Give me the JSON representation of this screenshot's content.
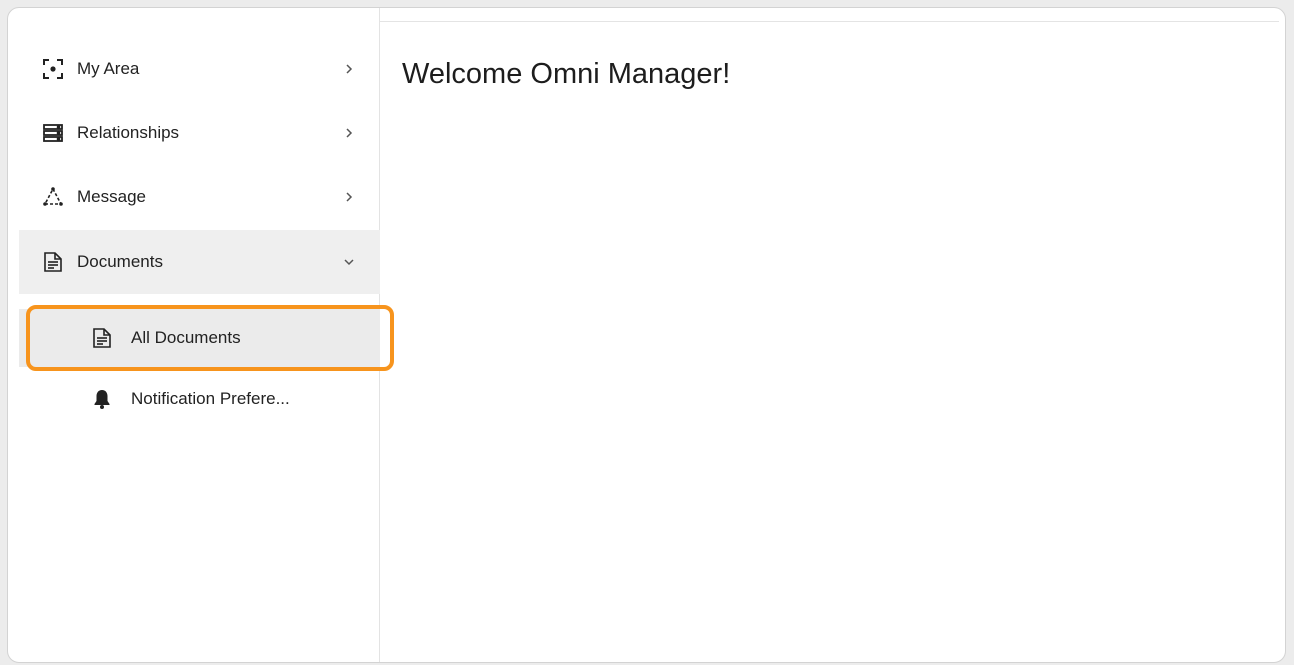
{
  "main": {
    "welcome_title": "Welcome Omni Manager!"
  },
  "sidebar": {
    "items": [
      {
        "label": "My Area",
        "icon": "focus-frame-icon",
        "state": "collapsed"
      },
      {
        "label": "Relationships",
        "icon": "server-stack-icon",
        "state": "collapsed"
      },
      {
        "label": "Message",
        "icon": "recycle-triangle-icon",
        "state": "collapsed"
      },
      {
        "label": "Documents",
        "icon": "document-icon",
        "state": "expanded"
      }
    ],
    "documents_children": [
      {
        "label": "All Documents",
        "icon": "document-icon",
        "selected": true
      },
      {
        "label": "Notification Prefere...",
        "icon": "bell-icon",
        "selected": false
      }
    ]
  },
  "colors": {
    "highlight": "#f7941d",
    "active_background": "#ebebeb"
  }
}
